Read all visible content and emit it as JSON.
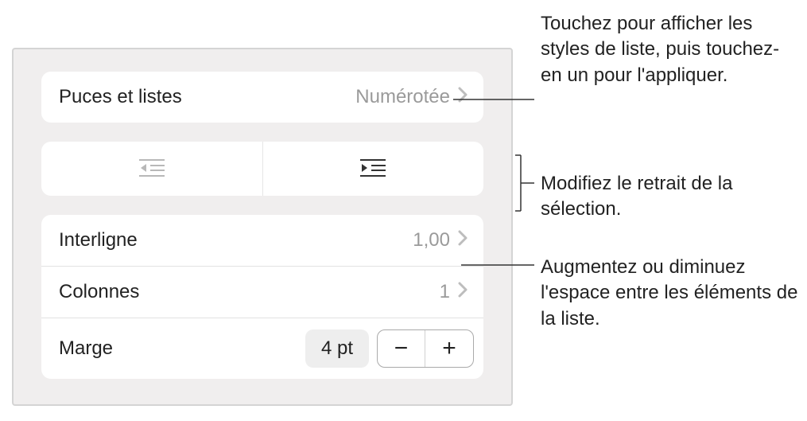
{
  "bullets_row": {
    "label": "Puces et listes",
    "value": "Numérotée"
  },
  "interline_row": {
    "label": "Interligne",
    "value": "1,00"
  },
  "columns_row": {
    "label": "Colonnes",
    "value": "1"
  },
  "margin_row": {
    "label": "Marge",
    "value": "4 pt"
  },
  "callouts": {
    "bullets": "Touchez pour afficher les styles de liste, puis touchez-en un pour l'appliquer.",
    "indent": "Modifiez le retrait de la sélection.",
    "interline": "Augmentez ou diminuez l'espace entre les éléments de la liste."
  }
}
